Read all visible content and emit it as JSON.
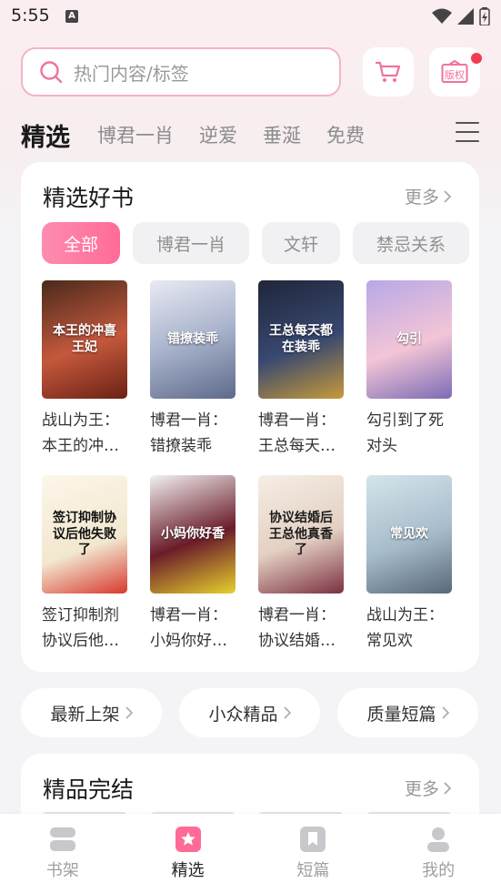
{
  "status_bar": {
    "time": "5:55",
    "app_indicator": "A"
  },
  "search": {
    "placeholder": "热门内容/标签"
  },
  "header_icons": {
    "cart": "cart-icon",
    "copyright": "版权"
  },
  "tabs": [
    {
      "label": "精选",
      "active": true
    },
    {
      "label": "博君一肖"
    },
    {
      "label": "逆爱"
    },
    {
      "label": "垂涎"
    },
    {
      "label": "免费"
    }
  ],
  "featured": {
    "title": "精选好书",
    "more": "更多",
    "filters": [
      {
        "label": "全部",
        "active": true
      },
      {
        "label": "博君一肖"
      },
      {
        "label": "文轩"
      },
      {
        "label": "禁忌关系"
      }
    ],
    "books": [
      {
        "title": "战山为王：本王的冲…",
        "cover_text": "本王的冲喜王妃"
      },
      {
        "title": "博君一肖：错撩装乖",
        "cover_text": "错撩装乖"
      },
      {
        "title": "博君一肖：王总每天…",
        "cover_text": "王总每天都在装乖"
      },
      {
        "title": "勾引到了死对头",
        "cover_text": "勾引"
      },
      {
        "title": "签订抑制剂协议后他…",
        "cover_text": "签订抑制协议后他失败了"
      },
      {
        "title": "博君一肖：小妈你好…",
        "cover_text": "小妈你好香"
      },
      {
        "title": "博君一肖：协议结婚…",
        "cover_text": "协议结婚后王总他真香了"
      },
      {
        "title": "战山为王：常见欢",
        "cover_text": "常见欢"
      }
    ]
  },
  "quick_links": [
    {
      "label": "最新上架"
    },
    {
      "label": "小众精品"
    },
    {
      "label": "质量短篇"
    }
  ],
  "complete": {
    "title": "精品完结",
    "more": "更多"
  },
  "bottom_nav": [
    {
      "label": "书架",
      "icon": "bookshelf-icon"
    },
    {
      "label": "精选",
      "icon": "featured-star-icon",
      "active": true
    },
    {
      "label": "短篇",
      "icon": "short-book-icon"
    },
    {
      "label": "我的",
      "icon": "profile-icon"
    }
  ],
  "colors": {
    "accent": "#ff6b96",
    "search_border": "#f6b4c6",
    "badge": "#f23c4d"
  }
}
